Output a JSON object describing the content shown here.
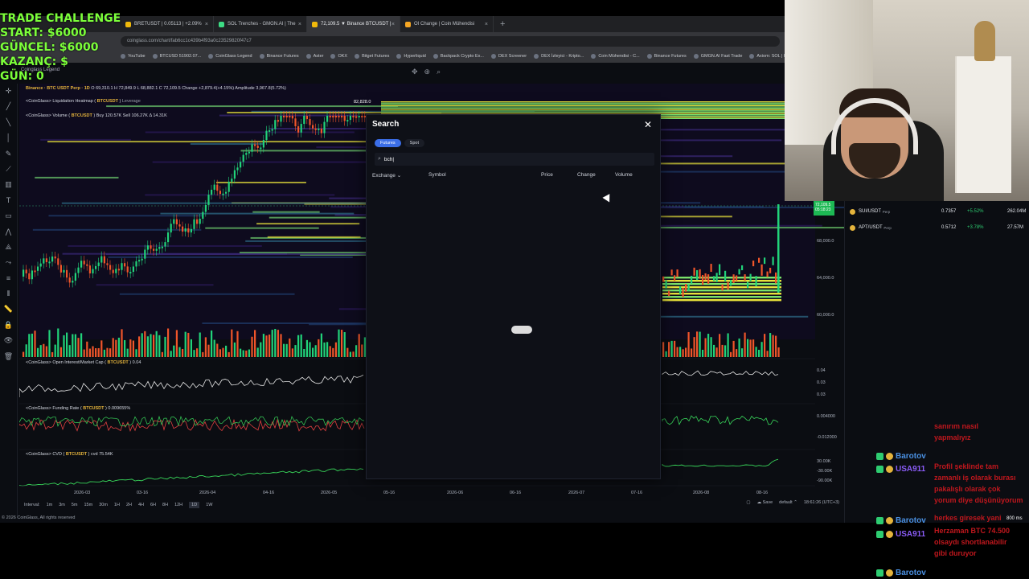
{
  "overlay": {
    "line1": "TRADE CHALLENGE",
    "line2": "START: $6000",
    "line3": "GÜNCEL: $6000",
    "line4": "KAZANÇ: $",
    "line5": "GÜN: 0"
  },
  "browser": {
    "tabs": [
      {
        "label": "BRETUSDT | 0.05113 | +2.09%"
      },
      {
        "label": "SOL Trenches - GMGN.AI | The"
      },
      {
        "label": "72,109.5 ▼ Binance BTCUSDT |"
      },
      {
        "label": "OI Change | Coin Mühendisi"
      }
    ],
    "url": "coinglass.com/chart/fab6cc1c439b4f93a0c23529820f47c7",
    "bookmarks": [
      "YouTube",
      "BTCUSD 51902.07...",
      "CoinGlass Legend",
      "Binance Futures",
      "Aster",
      "OKX",
      "Bitget Futures",
      "Hyperliquid",
      "Backpack Crypto Ex...",
      "DEX Screener",
      "DEX İzleyici - Kripto...",
      "Coin Mühendisi - C...",
      "Binance Futures",
      "GMGN.AI Fast Trade",
      "Axiom: SOL | Pulse"
    ]
  },
  "chart": {
    "main_title": "Binance · BTC USDT Perp · 1D",
    "ohlc": "O 69,310.1  H 72,849.9  L 68,882.1  C 72,109.5  Change +2,879.4(+4.15%)  Amplitude 3,967.8(5.72%)",
    "legend_label": "Coinglass Legend",
    "ind_heatmap": "<CoinGlass> Liquidation Heatmap",
    "ind_heatmap_pair": "BTCUSDT",
    "ind_heatmap_extra": "Leverage",
    "ind_volume": "<CoinGlass> Volume",
    "ind_volume_pair": "BTCUSDT",
    "ind_volume_vals": "Buy 120.57K  Sell 106.27K  Δ 14.31K",
    "ind_oi": "<CoinGlass> Open Interest/Market Cap",
    "ind_oi_pair": "BTCUSDT",
    "ind_oi_val": "0.04",
    "ind_funding": "<CoinGlass> Funding Rate",
    "ind_funding_pair": "BTCUSDT",
    "ind_funding_val": "0.009655%",
    "ind_cvd": "<CoinGlass> CVD",
    "ind_cvd_pair": "BTCUSDT",
    "ind_cvd_val": "cvd 75.54K",
    "peak_label": "82,828.0",
    "price_tag": "72,109.5",
    "price_tag_time": "05:18:23",
    "y_labels": [
      "68,000.0",
      "64,000.0",
      "60,000.0"
    ],
    "oi_y": [
      "0.04",
      "0.03",
      "0.03"
    ],
    "fund_y": [
      "0.004000",
      "-0.012000"
    ],
    "cvd_y": [
      "30.00K",
      "-30.00K",
      "-90.00K"
    ],
    "x_labels": [
      "2026-03",
      "03-16",
      "2026-04",
      "04-16",
      "2026-05",
      "05-16",
      "2026-06",
      "06-16",
      "2026-07",
      "07-16",
      "2026-08",
      "08-16"
    ]
  },
  "bottombar": {
    "interval_label": "Interval:",
    "intervals": [
      "1m",
      "3m",
      "5m",
      "15m",
      "30m",
      "1H",
      "2H",
      "4H",
      "6H",
      "8H",
      "12H",
      "1D",
      "1W"
    ],
    "selected": "1D",
    "save": "Save",
    "layout": "default",
    "clock": "18:61:26 (UTC+3)"
  },
  "footer": "© 2026 CoinGlass, All rights reserved",
  "watchlist": [
    {
      "symbol": "SUI/USDT",
      "type": "Perp",
      "price": "0.7357",
      "change": "+5.52%",
      "volume": "262.04M"
    },
    {
      "symbol": "APT/USDT",
      "type": "Perp",
      "price": "0.5712",
      "change": "+3.78%",
      "volume": "27.57M"
    }
  ],
  "search_modal": {
    "title": "Search",
    "tab_futures": "Futures",
    "tab_spot": "Spot",
    "query": "bch|",
    "col_exchange": "Exchange",
    "col_symbol": "Symbol",
    "col_price": "Price",
    "col_change": "Change",
    "col_volume": "Volume"
  },
  "chat": {
    "messages": [
      {
        "user": "Barotov",
        "color": "#4a90e2",
        "text": ""
      },
      {
        "user": "USA911",
        "color": "#8a5cf6",
        "text": ""
      },
      {
        "user": "Barotov",
        "color": "#4a90e2",
        "text": ""
      },
      {
        "user": "USA911",
        "color": "#8a5cf6",
        "text": ""
      },
      {
        "user": "Barotov",
        "color": "#4a90e2",
        "text": ""
      }
    ],
    "texts": [
      "sanırım nasıl",
      "yapmalıyız",
      "Profil şeklinde tam",
      "zamanlı iş olarak burası",
      "pakalışlı olarak çok",
      "yorum diye düşünüyorum",
      "herkes giresek yani",
      "Herzaman BTC 74.500",
      "olsaydı shortlanabilir",
      "gibi duruyor"
    ],
    "ms": "800 ms"
  }
}
